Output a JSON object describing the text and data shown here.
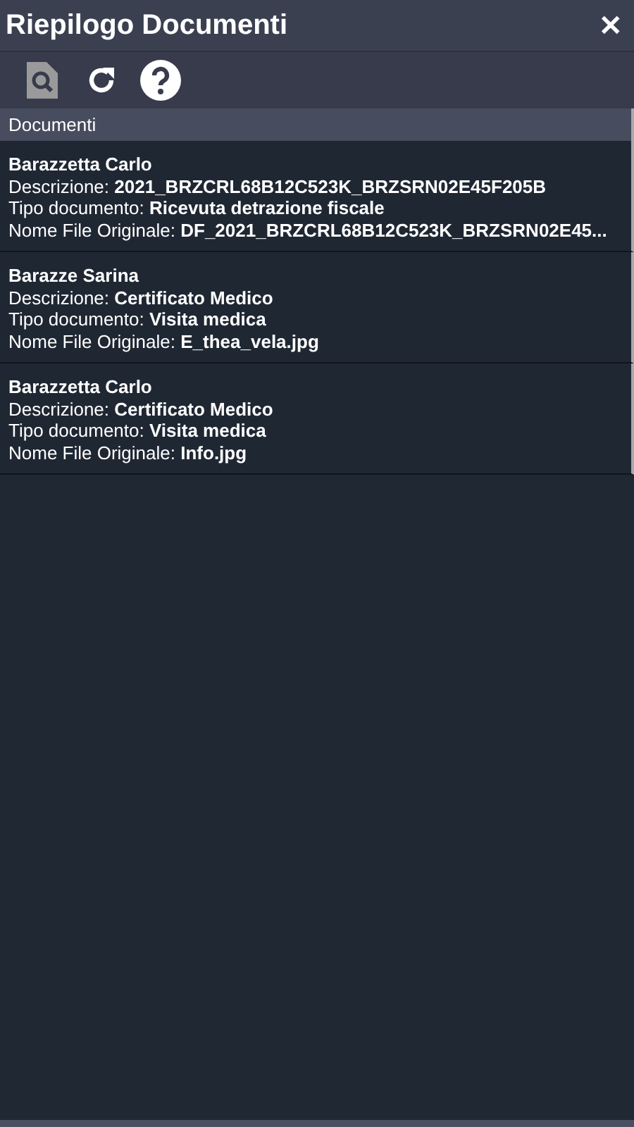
{
  "window": {
    "title": "Riepilogo Documenti",
    "close": "✕"
  },
  "toolbar": [
    {
      "kind": "preview",
      "disabled": true
    },
    {
      "kind": "refresh",
      "disabled": false
    },
    {
      "kind": "help",
      "disabled": false
    }
  ],
  "list": {
    "header": "Documenti",
    "rows": [
      {
        "name": "Barazzetta Carlo",
        "fields": [
          {
            "label": "Descrizione:",
            "value": "2021_BRZCRL68B12C523K_BRZSRN02E45F205B"
          },
          {
            "label": "Tipo documento:",
            "value": "Ricevuta detrazione fiscale"
          },
          {
            "label": "Nome File Originale:",
            "value": "DF_2021_BRZCRL68B12C523K_BRZSRN02E45..."
          }
        ]
      },
      {
        "name": "Barazze Sarina",
        "fields": [
          {
            "label": "Descrizione:",
            "value": "Certificato Medico"
          },
          {
            "label": "Tipo documento:",
            "value": "Visita medica"
          },
          {
            "label": "Nome File Originale:",
            "value": "E_thea_vela.jpg"
          }
        ]
      },
      {
        "name": "Barazzetta Carlo",
        "fields": [
          {
            "label": "Descrizione:",
            "value": "Certificato Medico"
          },
          {
            "label": "Tipo documento:",
            "value": "Visita medica"
          },
          {
            "label": "Nome File Originale:",
            "value": "Info.jpg"
          }
        ]
      }
    ]
  }
}
